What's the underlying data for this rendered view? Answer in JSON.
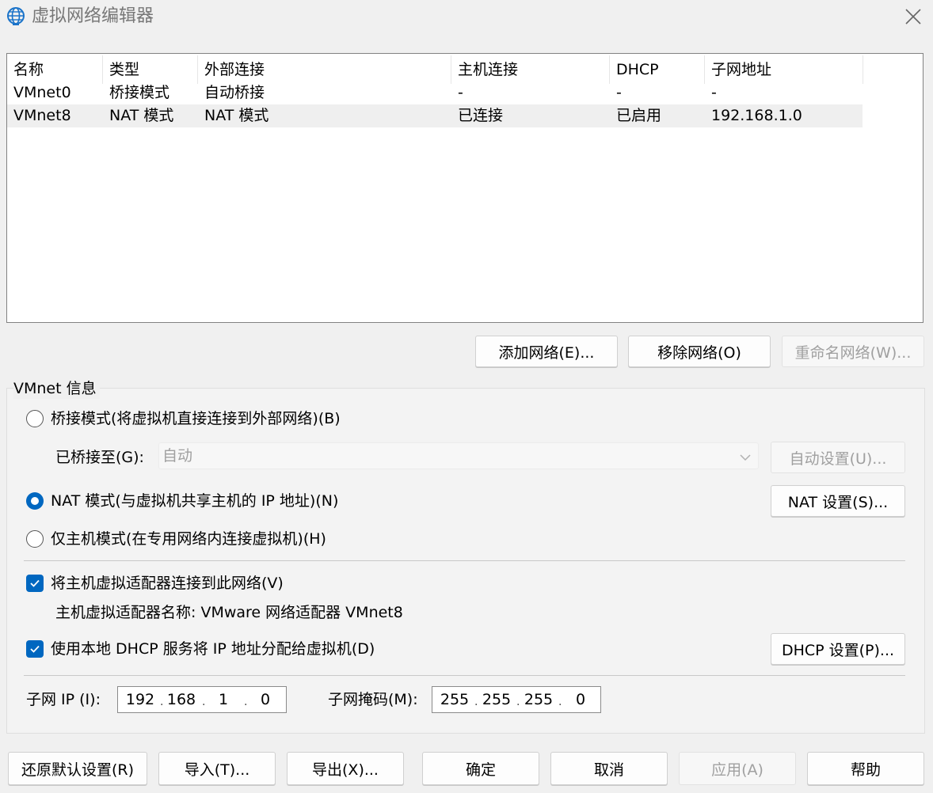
{
  "window": {
    "title": "虚拟网络编辑器"
  },
  "table": {
    "columns": [
      "名称",
      "类型",
      "外部连接",
      "主机连接",
      "DHCP",
      "子网地址"
    ],
    "rows": [
      [
        "VMnet0",
        "桥接模式",
        "自动桥接",
        "-",
        "-",
        "-"
      ],
      [
        "VMnet8",
        "NAT 模式",
        "NAT 模式",
        "已连接",
        "已启用",
        "192.168.1.0"
      ]
    ],
    "selected_row": 1
  },
  "table_buttons": {
    "add": "添加网络(E)...",
    "remove": "移除网络(O)",
    "rename": "重命名网络(W)..."
  },
  "info": {
    "group_label": "VMnet 信息",
    "bridge_label": "桥接模式(将虚拟机直接连接到外部网络)(B)",
    "bridged_to_label": "已桥接至(G):",
    "bridged_to_value": "自动",
    "auto_settings_button": "自动设置(U)...",
    "nat_label": "NAT 模式(与虚拟机共享主机的 IP 地址)(N)",
    "nat_settings_button": "NAT 设置(S)...",
    "hostonly_label": "仅主机模式(在专用网络内连接虚拟机)(H)",
    "selected_mode": "nat",
    "connect_adapter_label": "将主机虚拟适配器连接到此网络(V)",
    "connect_adapter_checked": true,
    "adapter_name_text": "主机虚拟适配器名称: VMware 网络适配器 VMnet8",
    "dhcp_label": "使用本地 DHCP 服务将 IP 地址分配给虚拟机(D)",
    "dhcp_checked": true,
    "dhcp_settings_button": "DHCP 设置(P)...",
    "subnet_ip_label": "子网 IP (I):",
    "subnet_ip": [
      "192",
      "168",
      "1",
      "0"
    ],
    "subnet_mask_label": "子网掩码(M):",
    "subnet_mask": [
      "255",
      "255",
      "255",
      "0"
    ]
  },
  "footer": {
    "restore": "还原默认设置(R)",
    "import": "导入(T)...",
    "export": "导出(X)...",
    "ok": "确定",
    "cancel": "取消",
    "apply": "应用(A)",
    "help": "帮助"
  },
  "colors": {
    "accent": "#0067c0",
    "selected_row": "#efefef"
  }
}
